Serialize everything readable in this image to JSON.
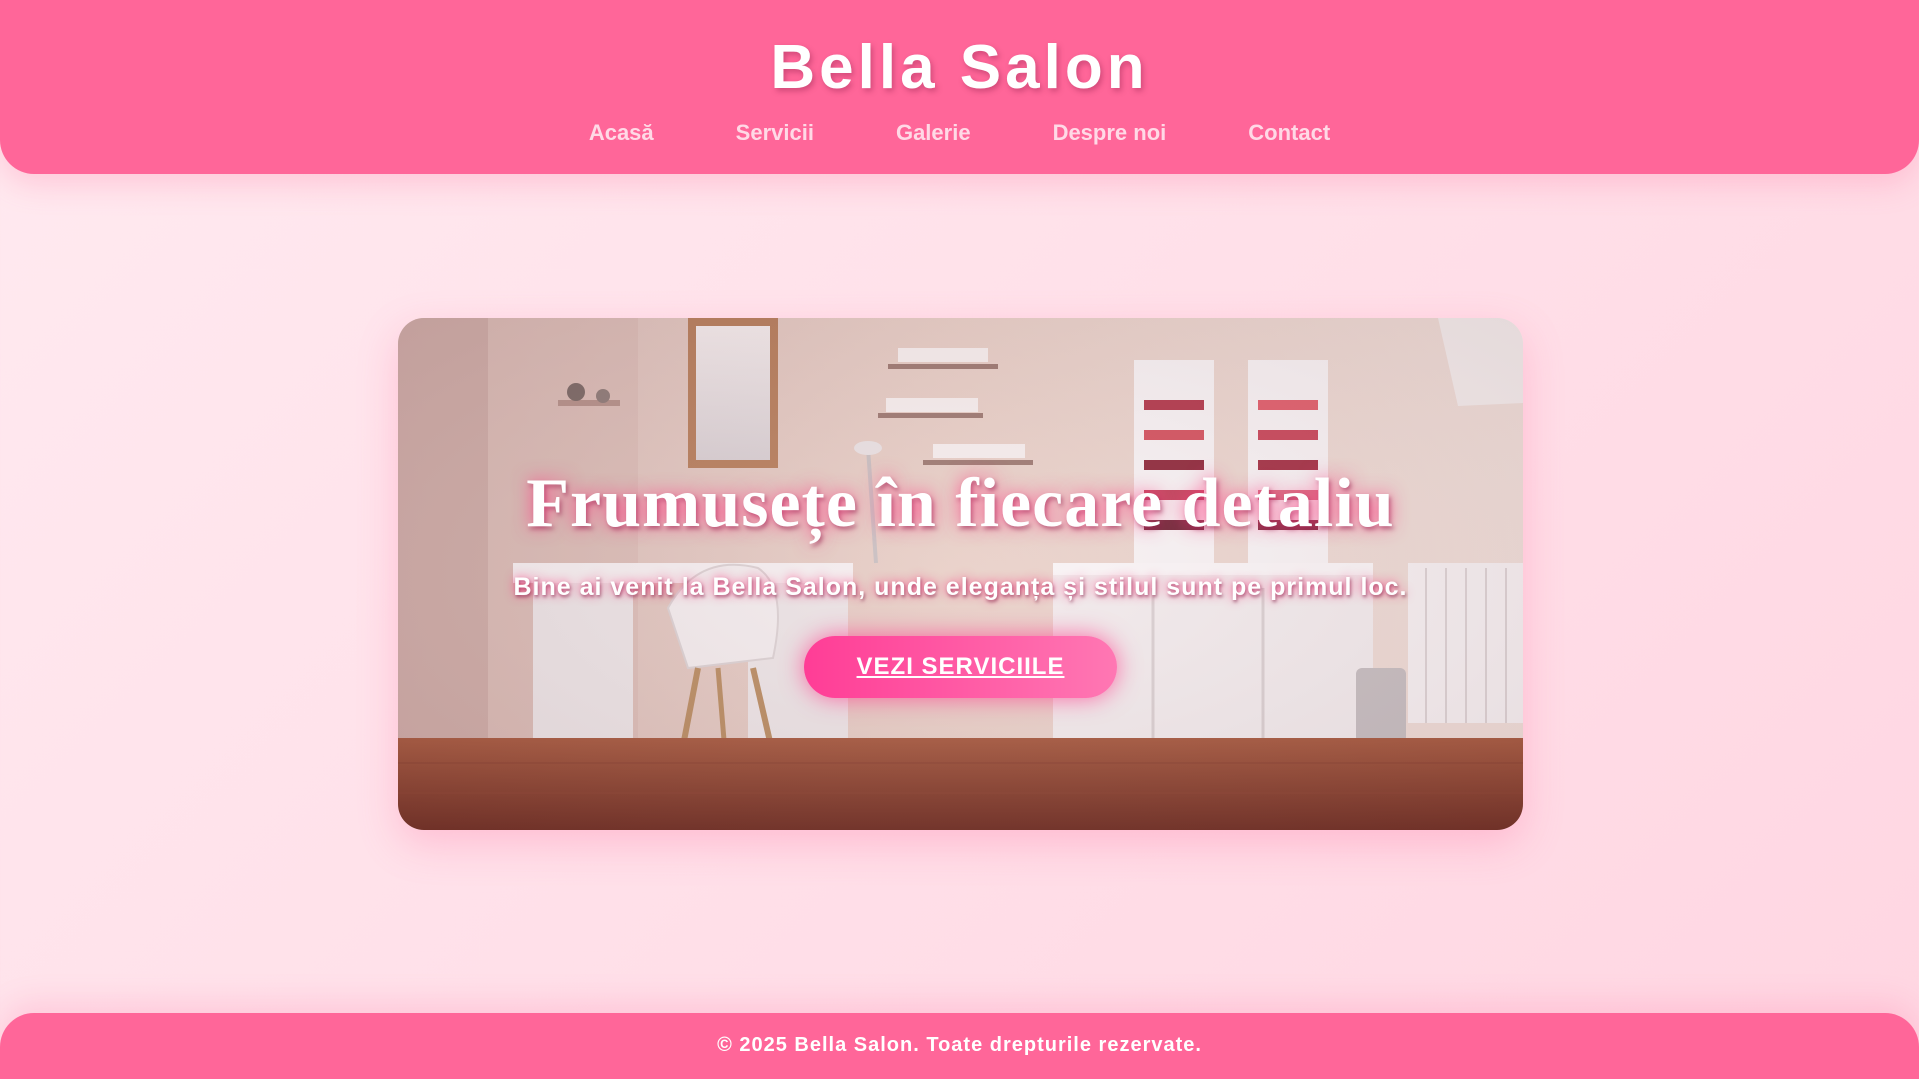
{
  "header": {
    "brand": "Bella Salon",
    "nav": [
      {
        "label": "Acasă"
      },
      {
        "label": "Servicii"
      },
      {
        "label": "Galerie"
      },
      {
        "label": "Despre noi"
      },
      {
        "label": "Contact"
      }
    ]
  },
  "hero": {
    "title": "Frumusețe în fiecare detaliu",
    "subtitle": "Bine ai venit la Bella Salon, unde eleganța și stilul sunt pe primul loc.",
    "cta_label": "VEZI SERVICIILE",
    "image_icon": "salon-interior-photo"
  },
  "footer": {
    "text": "© 2025 Bella Salon. Toate drepturile rezervate."
  },
  "colors": {
    "primary": "#ff6699",
    "cta_start": "#ff3d96",
    "cta_end": "#ff77b3",
    "nav_text": "#ffd9e6",
    "page_bg": "#ffe0e9"
  }
}
